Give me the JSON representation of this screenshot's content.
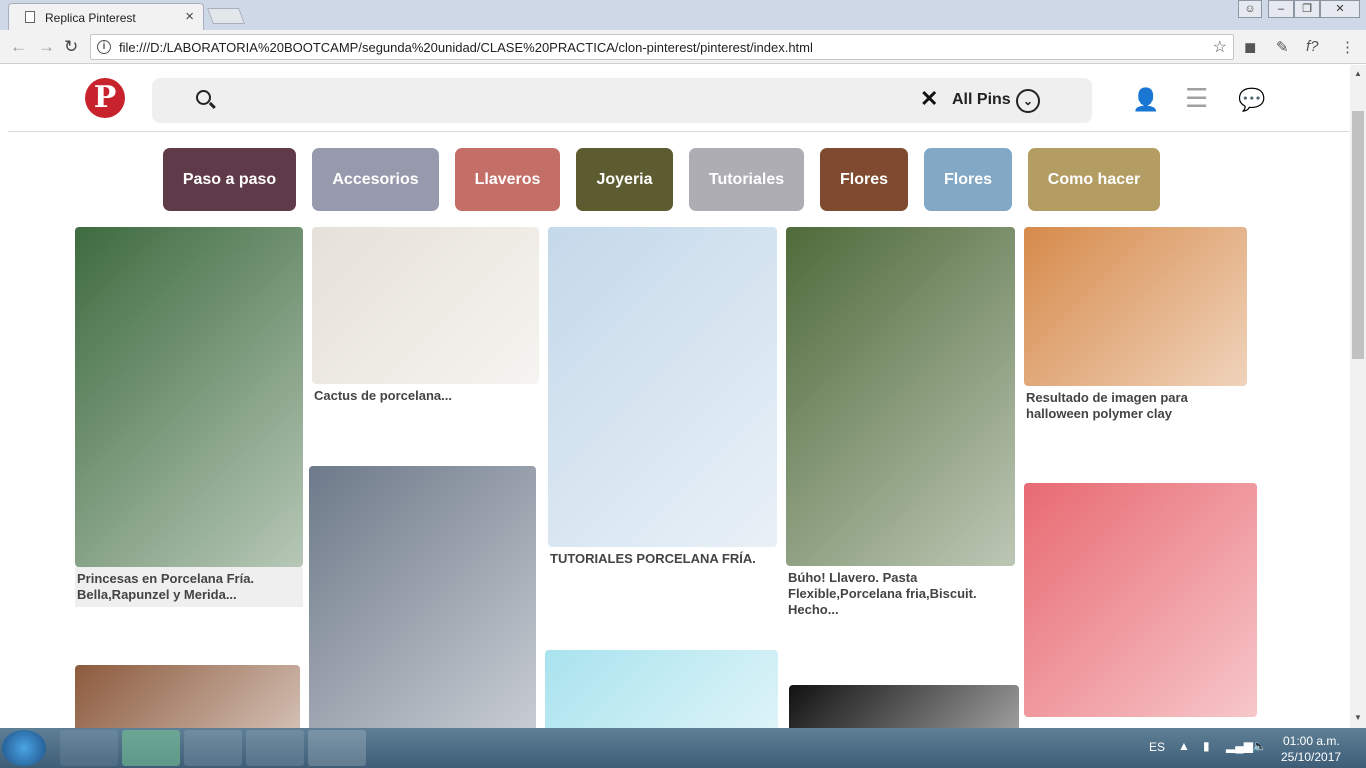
{
  "browser": {
    "tab_title": "Replica Pinterest",
    "url": "file:///D:/LABORATORIA%20BOOTCAMP/segunda%20unidad/CLASE%20PRACTICA/clon-pinterest/pinterest/index.html"
  },
  "header": {
    "logo": "P",
    "search_placeholder": "",
    "filter_label": "All Pins"
  },
  "categories": [
    {
      "label": "Paso a paso",
      "color": "#5f3b49"
    },
    {
      "label": "Accesorios",
      "color": "#979aac"
    },
    {
      "label": "Llaveros",
      "color": "#c46e68"
    },
    {
      "label": "Joyeria",
      "color": "#5d5c31"
    },
    {
      "label": "Tutoriales",
      "color": "#aeadb3"
    },
    {
      "label": "Flores",
      "color": "#804a30"
    },
    {
      "label": "Flores",
      "color": "#83a8c6"
    },
    {
      "label": "Como hacer",
      "color": "#b39d63"
    }
  ],
  "pins": [
    {
      "caption": "Princesas en Porcelana Fría. Bella,Rapunzel y Merida...",
      "color": "#3e6b3f"
    },
    {
      "caption": "Cactus de porcelana...",
      "color": "#e6e1d8"
    },
    {
      "caption": "TUTORIALES PORCELANA FRÍA.",
      "color": "#c4d9ea"
    },
    {
      "caption": "Búho! Llavero. Pasta Flexible,Porcelana fria,Biscuit. Hecho...",
      "color": "#4f6a3a"
    },
    {
      "caption": "Resultado de imagen para halloween polymer clay",
      "color": "#d68a4a"
    },
    {
      "caption": "",
      "color": "#8c5a3c"
    },
    {
      "caption": "",
      "color": "#6e7a8a"
    },
    {
      "caption": "",
      "color": "#a9e3ee"
    },
    {
      "caption": "",
      "color": "#111111"
    },
    {
      "caption": "",
      "color": "#e86a72"
    }
  ],
  "taskbar": {
    "language": "ES",
    "time": "01:00 a.m.",
    "date": "25/10/2017"
  }
}
